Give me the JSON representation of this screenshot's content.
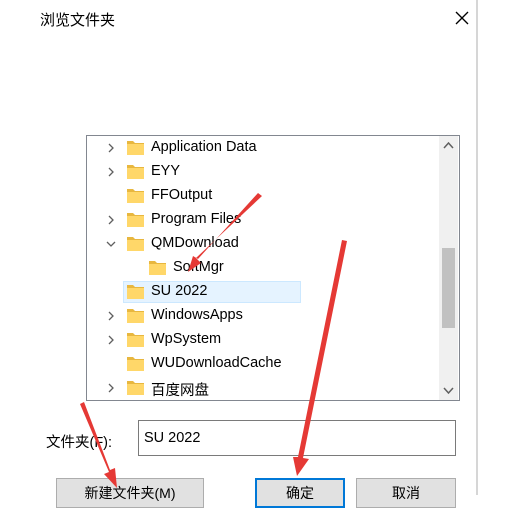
{
  "window": {
    "title": "浏览文件夹",
    "close_icon": "close-icon"
  },
  "tree": {
    "items": [
      {
        "label": "Application Data",
        "expander": "collapsed"
      },
      {
        "label": "EYY",
        "expander": "collapsed"
      },
      {
        "label": "FFOutput",
        "expander": "none"
      },
      {
        "label": "Program Files",
        "expander": "collapsed"
      },
      {
        "label": "QMDownload",
        "expander": "expanded"
      },
      {
        "label": "SoftMgr",
        "expander": "none",
        "level": 2
      },
      {
        "label": "SU 2022",
        "expander": "none",
        "selected": true
      },
      {
        "label": "WindowsApps",
        "expander": "collapsed"
      },
      {
        "label": "WpSystem",
        "expander": "collapsed"
      },
      {
        "label": "WUDownloadCache",
        "expander": "none"
      },
      {
        "label": "百度网盘",
        "expander": "collapsed"
      }
    ]
  },
  "folder_field": {
    "label": "文件夹(F):",
    "value": "SU 2022"
  },
  "buttons": {
    "new_folder": "新建文件夹(M)",
    "ok": "确定",
    "cancel": "取消"
  },
  "colors": {
    "folder": "#ffd769",
    "selection": "#e5f3ff",
    "arrow_annotation": "#e53935",
    "accent": "#0078d7"
  }
}
